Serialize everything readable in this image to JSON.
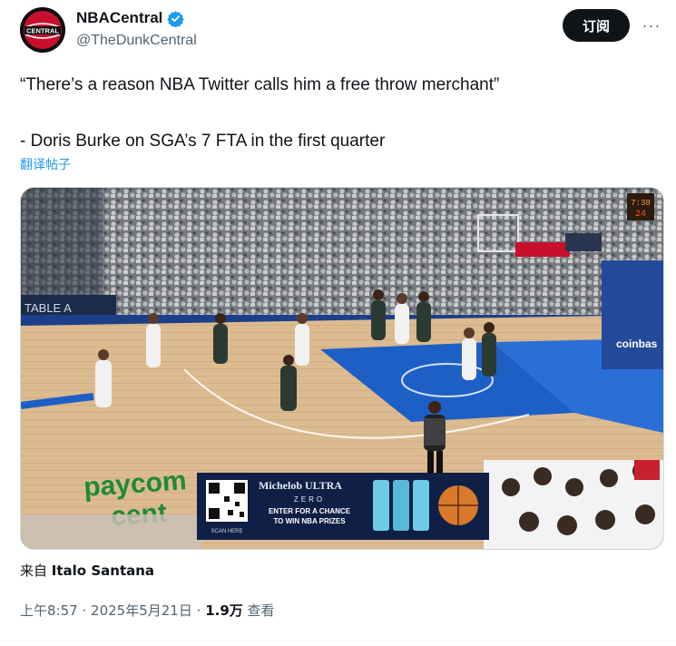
{
  "account": {
    "display_name": "NBACentral",
    "handle": "@TheDunkCentral",
    "avatar_text": "CENTRAL"
  },
  "actions": {
    "follow_label": "订阅",
    "more_label": "···"
  },
  "tweet": {
    "line1": "“There’s a reason NBA Twitter calls him a free throw merchant”",
    "line2": "- Doris Burke on SGA’s 7 FTA in the first quarter",
    "translate_label": "翻译帖子"
  },
  "video": {
    "scoreboard_clock": "7:38",
    "shot_clock": "24",
    "sponsor_left": "paycom",
    "sponsor_left_2": "cent",
    "sponsor_right": "coinbas",
    "stand_banner": "TABLE A",
    "ad_brand": "Michelob ULTRA",
    "ad_sub": "ZERO",
    "ad_line1": "ENTER FOR A CHANCE",
    "ad_line2": "TO WIN NBA PRIZES",
    "ad_qr_caption": "SCAN HERE"
  },
  "footer": {
    "source_prefix": "来自",
    "source_name": "Italo Santana",
    "time": "上午8:57",
    "date": "2025年5月21日",
    "views": "1.9万",
    "views_label": "查看",
    "separator": "·"
  },
  "colors": {
    "accent_blue": "#1d9bf0",
    "court_blue": "#1e5fc6",
    "court_wood": "#d8b58a"
  }
}
